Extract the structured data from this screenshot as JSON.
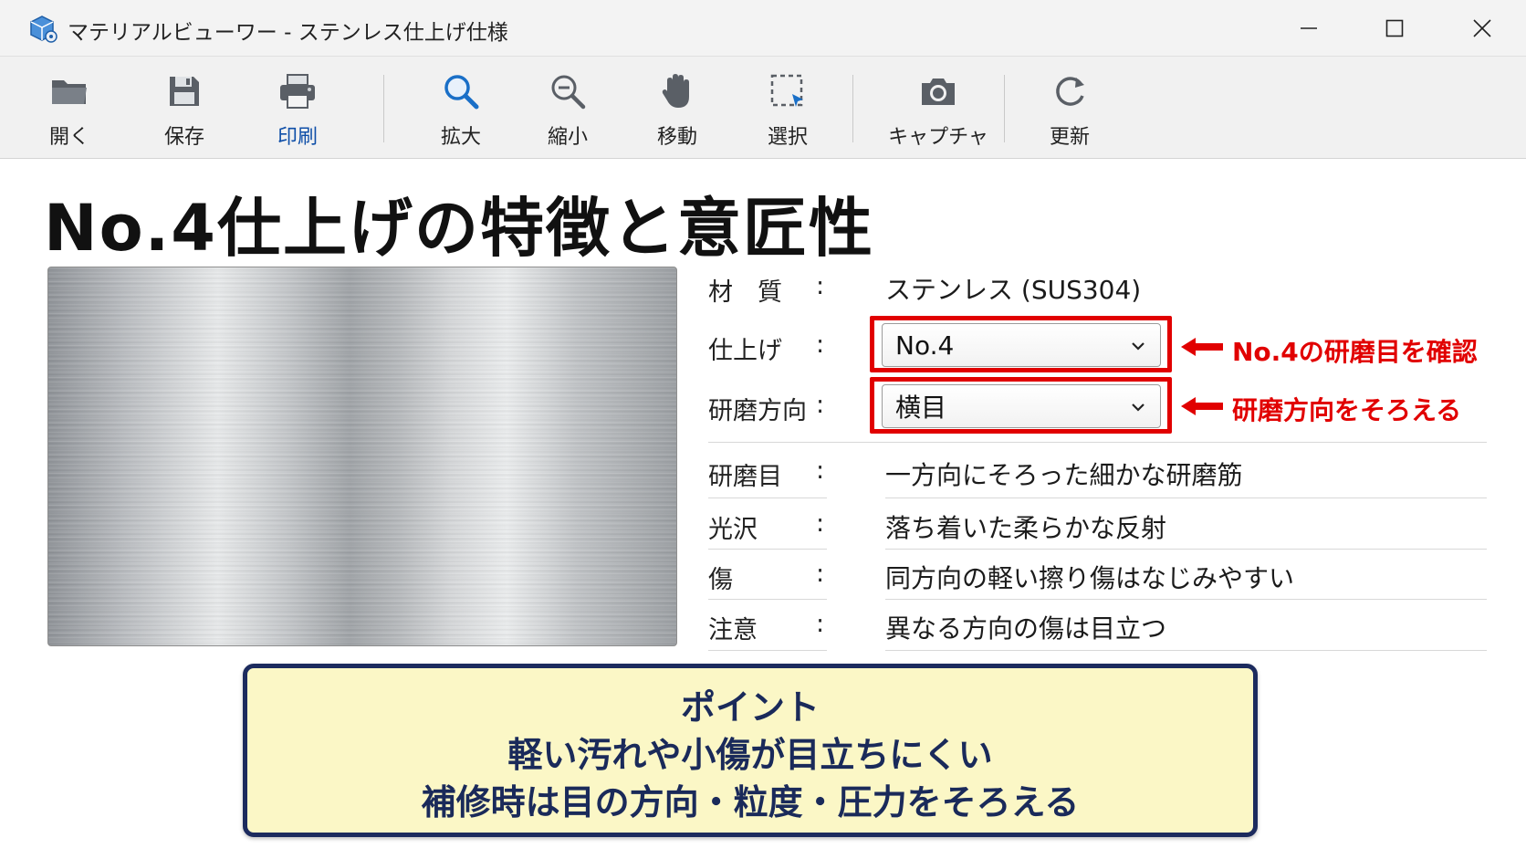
{
  "window": {
    "title": "マテリアルビューワー - ステンレス仕上げ仕様",
    "app_icon": "cube-gear-icon",
    "controls": [
      "minimize-icon",
      "maximize-icon",
      "close-icon"
    ]
  },
  "toolbar": {
    "items": [
      {
        "label": "開く",
        "icon": "folder-icon"
      },
      {
        "label": "保存",
        "icon": "save-icon"
      },
      {
        "label": "印刷",
        "icon": "printer-icon",
        "active": true
      },
      {
        "label": "拡大",
        "icon": "zoom-in-icon"
      },
      {
        "label": "縮小",
        "icon": "zoom-out-icon"
      },
      {
        "label": "移動",
        "icon": "hand-icon"
      },
      {
        "label": "選択",
        "icon": "select-icon"
      },
      {
        "label": "キャプチャ",
        "icon": "camera-icon"
      },
      {
        "label": "更新",
        "icon": "refresh-icon"
      }
    ]
  },
  "main": {
    "heading": "No.4仕上げの特徴と意匠性",
    "swatch": "brushed-stainless-swatch",
    "properties": {
      "material": {
        "label": "材　質",
        "colon": ":",
        "value": "ステンレス (SUS304)"
      },
      "finish": {
        "label": "仕上げ",
        "colon": ":",
        "value": "No.4"
      },
      "direction": {
        "label": "研磨方向",
        "colon": ":",
        "value": "横目"
      }
    },
    "annotations": {
      "finish_note": "No.4の研磨目を確認",
      "direction_note": "研磨方向をそろえる",
      "highlight_color": "#e10000"
    },
    "details": [
      {
        "label": "研磨目",
        "colon": ":",
        "value": "一方向にそろった細かな研磨筋"
      },
      {
        "label": "光沢",
        "colon": ":",
        "value": "落ち着いた柔らかな反射"
      },
      {
        "label": "傷",
        "colon": ":",
        "value": "同方向の軽い擦り傷はなじみやすい"
      },
      {
        "label": "注意",
        "colon": ":",
        "value": "異なる方向の傷は目立つ"
      }
    ]
  },
  "point": {
    "title": "ポイント",
    "line1": "軽い汚れや小傷が目立ちにくい",
    "line2": "補修時は目の方向・粒度・圧力をそろえる",
    "background": "#fbf7c6",
    "border": "#1c2b5e"
  }
}
